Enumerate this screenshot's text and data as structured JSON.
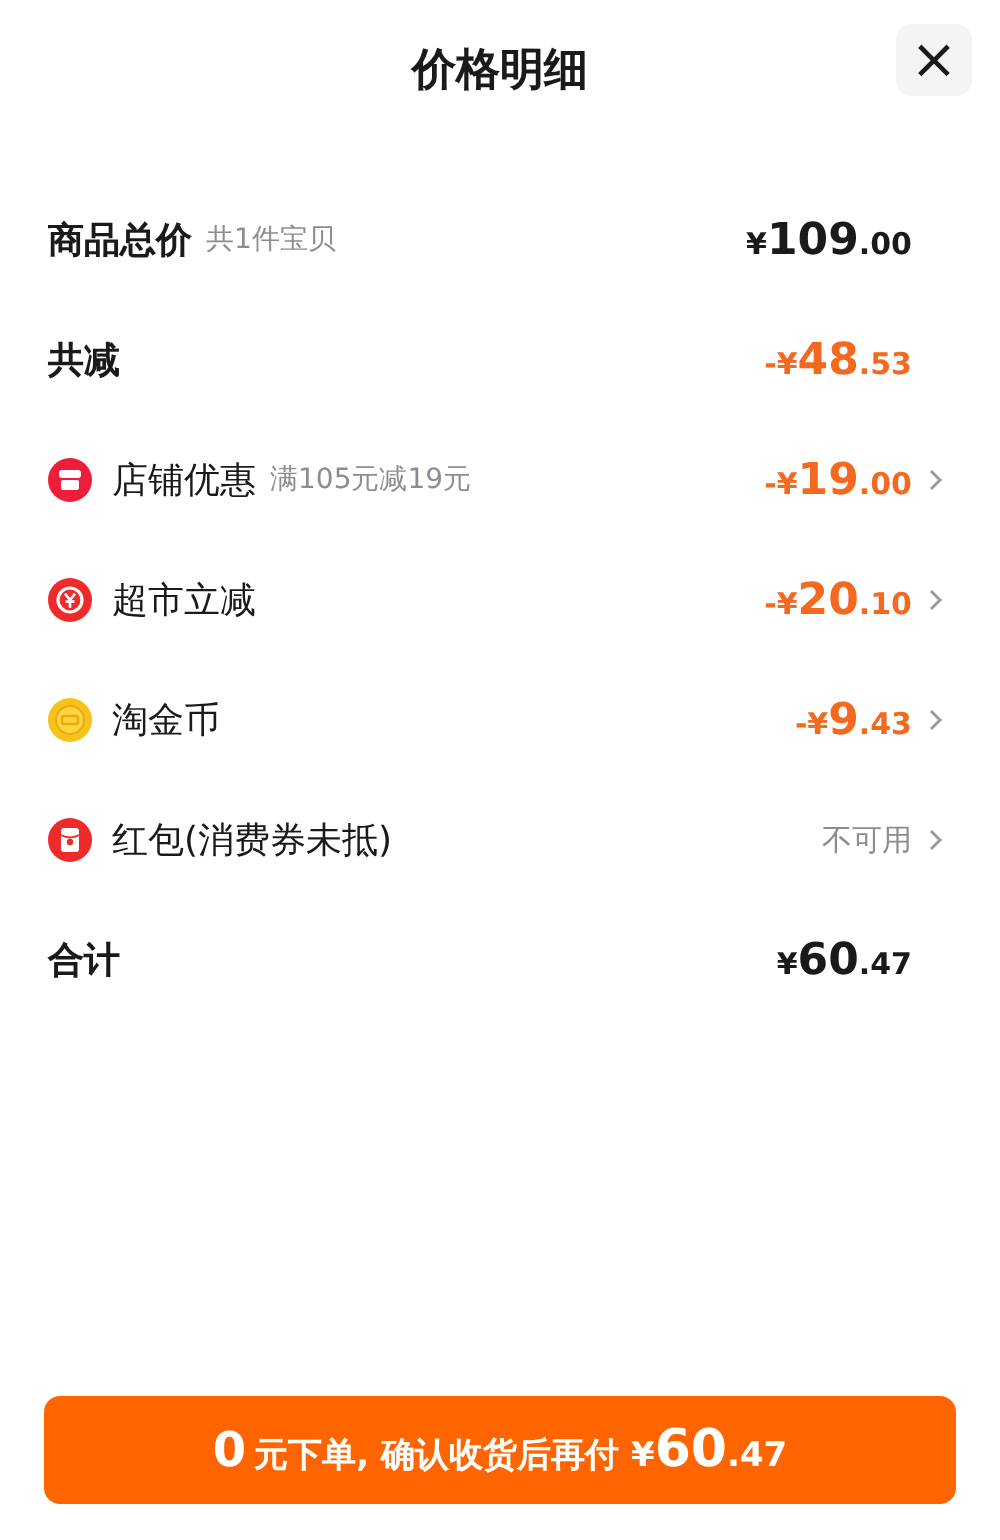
{
  "header": {
    "title": "价格明细",
    "close": "×"
  },
  "rows": [
    {
      "kind": "summary",
      "label": "商品总价",
      "note": "共1件宝贝",
      "amount": {
        "sign": "¥",
        "whole": "109",
        "cents": ".00"
      }
    },
    {
      "kind": "deduction-summary",
      "label": "共减",
      "amount": {
        "sign": "-¥",
        "whole": "48",
        "cents": ".53"
      }
    },
    {
      "kind": "shop-deduction",
      "label": "店铺优惠",
      "note": "满105元减19元",
      "amount": {
        "sign": "-¥",
        "whole": "19",
        "cents": ".00"
      }
    },
    {
      "kind": "market-deduction",
      "label": "超市立减",
      "amount": {
        "sign": "-¥",
        "whole": "20",
        "cents": ".10"
      }
    },
    {
      "kind": "coin-deduction",
      "label": "淘金币",
      "amount": {
        "sign": "-¥",
        "whole": "9",
        "cents": ".43"
      }
    },
    {
      "kind": "packet-option",
      "label": "红包(消费券未抵)",
      "status": "不可用"
    },
    {
      "kind": "summary",
      "label": "合计",
      "amount": {
        "sign": "¥",
        "whole": "60",
        "cents": ".47"
      }
    }
  ],
  "button": {
    "lead": "0",
    "text": "元下单, 确认收货后再付",
    "amount": {
      "sign": "¥",
      "whole": "60",
      "cents": ".47"
    }
  }
}
